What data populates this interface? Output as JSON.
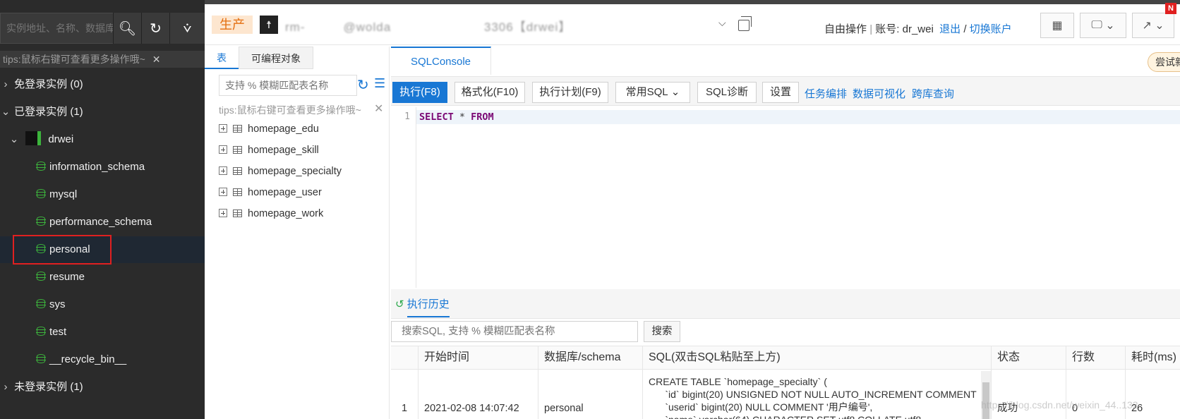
{
  "sidebar": {
    "search_placeholder": "实例地址、名称、数据库",
    "tips": "tips:鼠标右键可查看更多操作哦~",
    "groups": {
      "free": "免登录实例 (0)",
      "logged": "已登录实例 (1)",
      "unlogged": "未登录实例 (1)"
    },
    "instance": "drwei",
    "databases": [
      "information_schema",
      "mysql",
      "performance_schema",
      "personal",
      "resume",
      "sys",
      "test",
      "__recycle_bin__"
    ]
  },
  "topbar": {
    "env": "生产",
    "conn_name": "rm-   @wolda        3306【drwei】",
    "mode": "自由操作",
    "account_label": "账号: dr_wei",
    "logout": "退出",
    "sep": "/",
    "switch": "切换账户",
    "new_badge": "N"
  },
  "midpanel": {
    "tabs": [
      "表",
      "可编程对象"
    ],
    "search_placeholder": "支持 % 模糊匹配表名称",
    "tips": "tips:鼠标右键可查看更多操作哦~",
    "tables": [
      "homepage_edu",
      "homepage_skill",
      "homepage_specialty",
      "homepage_user",
      "homepage_work"
    ]
  },
  "editor": {
    "tab": "SQLConsole",
    "try_badge": "尝试新",
    "buttons": {
      "run": "执行(F8)",
      "format": "格式化(F10)",
      "plan": "执行计划(F9)",
      "common": "常用SQL",
      "diag": "SQL诊断",
      "settings": "设置"
    },
    "links": [
      "任务编排",
      "数据可视化",
      "跨库查询"
    ],
    "line_no": "1",
    "code_kw1": "SELECT",
    "code_star": " * ",
    "code_kw2": "FROM"
  },
  "history": {
    "tab": "执行历史",
    "search_placeholder": "搜索SQL, 支持 % 模糊匹配表名称",
    "search_btn": "搜索",
    "columns": [
      "开始时间",
      "数据库/schema",
      "SQL(双击SQL粘贴至上方)",
      "状态",
      "行数",
      "耗时(ms)"
    ],
    "rows": [
      {
        "idx": "1",
        "time": "2021-02-08 14:07:42",
        "db": "personal",
        "sql_lines": [
          "CREATE TABLE `homepage_specialty` (",
          "      `id` bigint(20) UNSIGNED NOT NULL AUTO_INCREMENT COMMENT",
          "      `userid` bigint(20) NULL COMMENT '用户编号',",
          "      `name` varchar(64) CHARACTER SET utf8 COLLATE utf8"
        ],
        "status": "成功",
        "rows": "0",
        "elapsed": "26"
      }
    ]
  },
  "watermark": "https://blog.csdn.net/weixin_44..132"
}
